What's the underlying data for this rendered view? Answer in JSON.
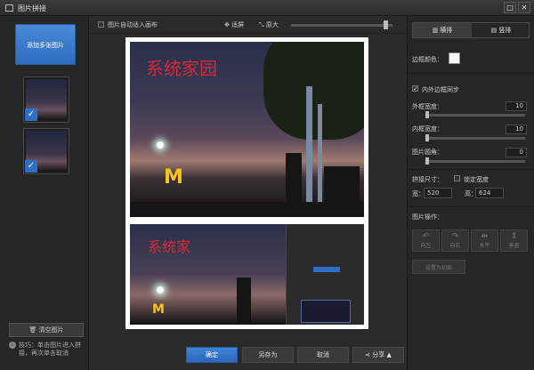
{
  "window": {
    "title": "图片拼接",
    "min_label": "□",
    "close_label": "✕"
  },
  "left": {
    "add_button": "添加多张图片",
    "clear_button": "清空图片",
    "tip_icon": "i",
    "tip_text": "技巧：单击图片进入拼接，再次单击取消",
    "thumb_check": "✓"
  },
  "toolbar": {
    "auto_fill_label": "图片自动适入画布",
    "fit_screen_label": "适屏",
    "original_size_label": "原大",
    "zoom_level": 0.95
  },
  "canvas": {
    "watermark1": "系统家园",
    "watermark2": "系统家",
    "mc_logo": "M"
  },
  "bottom": {
    "ok": "确定",
    "save_as": "另存为",
    "cancel": "取消",
    "share": "分享",
    "share_arrow": "▲"
  },
  "right": {
    "tab_horizontal": "横排",
    "tab_vertical": "竖排",
    "border_color_label": "边框颜色：",
    "border_color": "#ffffff",
    "sync_label": "内外边框同步",
    "sync_checked": true,
    "sync_mark": "✓",
    "outer_border_label": "外框宽度：",
    "outer_border_value": "10",
    "inner_border_label": "内框宽度：",
    "inner_border_value": "10",
    "corner_label": "图片圆角：",
    "corner_value": "0",
    "size_label": "拼接尺寸：",
    "lock_label": "锁定宽度",
    "width_label": "宽：",
    "width_value": "520",
    "height_label": "高：",
    "height_value": "624",
    "ops_label": "图片操作：",
    "ops": [
      "向左",
      "向右",
      "水平",
      "垂直"
    ],
    "bottom_label": "设置为初始"
  }
}
